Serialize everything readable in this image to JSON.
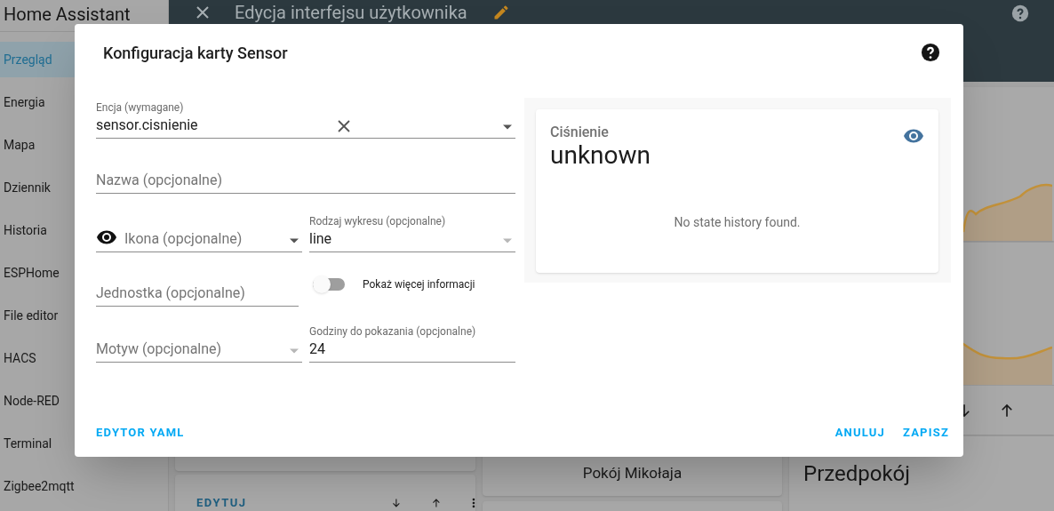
{
  "app": {
    "title": "Home Assistant"
  },
  "sidebar": {
    "items": [
      {
        "label": "Przegląd",
        "selected": true
      },
      {
        "label": "Energia",
        "selected": false
      },
      {
        "label": "Mapa",
        "selected": false
      },
      {
        "label": "Dziennik",
        "selected": false
      },
      {
        "label": "Historia",
        "selected": false
      },
      {
        "label": "ESPHome",
        "selected": false
      },
      {
        "label": "File editor",
        "selected": false
      },
      {
        "label": "HACS",
        "selected": false
      },
      {
        "label": "Node-RED",
        "selected": false
      },
      {
        "label": "Terminal",
        "selected": false
      },
      {
        "label": "Zigbee2mqtt",
        "selected": false
      }
    ]
  },
  "toolbar": {
    "title": "Edycja interfejsu użytkownika"
  },
  "dashboard": {
    "edit_button": "EDYTUJ",
    "room_button": "Pokój Mikołaja",
    "area_title": "Przedpokój"
  },
  "dialog": {
    "title": "Konfiguracja karty Sensor",
    "rows": [
      [
        {
          "kind": "entity",
          "label": "Encja (wymagane)",
          "value": "sensor.cisnienie"
        }
      ],
      [
        {
          "kind": "text",
          "placeholder": "Nazwa (opcjonalne)"
        }
      ],
      [
        {
          "kind": "icon",
          "placeholder": "Ikona (opcjonalne)"
        },
        {
          "kind": "select",
          "label": "Rodzaj wykresu (opcjonalne)",
          "value": "line"
        }
      ],
      [
        {
          "kind": "text",
          "placeholder": "Jednostka (opcjonalne)"
        },
        {
          "kind": "toggle",
          "label": "Pokaż więcej informacji",
          "on": false
        }
      ],
      [
        {
          "kind": "select",
          "placeholder": "Motyw (opcjonalne)"
        },
        {
          "kind": "number",
          "label": "Godziny do pokazania (opcjonalne)",
          "value": "24"
        }
      ]
    ],
    "preview": {
      "name": "Ciśnienie",
      "state": "unknown",
      "message": "No state history found."
    },
    "yaml_button": "EDYTOR YAML",
    "cancel_button": "ANULUJ",
    "save_button": "ZAPISZ"
  }
}
